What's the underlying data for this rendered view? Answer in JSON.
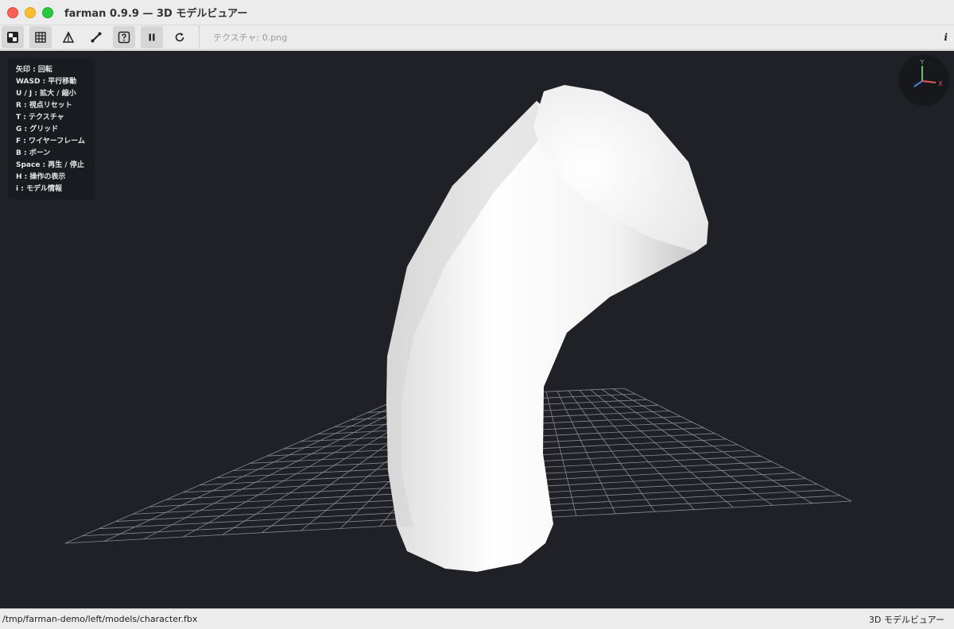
{
  "window": {
    "title": "farman 0.9.9 — 3D モデルビュアー"
  },
  "toolbar": {
    "buttons": [
      {
        "name": "texture-toggle-button",
        "icon": "texture-icon",
        "active": true
      },
      {
        "name": "grid-toggle-button",
        "icon": "grid-icon",
        "active": true
      },
      {
        "name": "wireframe-toggle-button",
        "icon": "wireframe-icon",
        "active": false
      },
      {
        "name": "bone-toggle-button",
        "icon": "bone-icon",
        "active": false
      },
      {
        "name": "help-toggle-button",
        "icon": "help-icon",
        "active": true
      },
      {
        "name": "pause-button",
        "icon": "pause-icon",
        "active": true
      },
      {
        "name": "reset-view-button",
        "icon": "reset-icon",
        "active": false
      }
    ],
    "texture_label": "テクスチャ: 0.png",
    "info_label": "i"
  },
  "help": {
    "lines": [
      "矢印 : 回転",
      "WASD : 平行移動",
      "U / J : 拡大 / 縮小",
      "R : 視点リセット",
      "T : テクスチャ",
      "G : グリッド",
      "F : ワイヤーフレーム",
      "B : ボーン",
      "Space : 再生 / 停止",
      "H : 操作の表示",
      "i : モデル情報"
    ]
  },
  "gizmo": {
    "y_label": "Y",
    "x_label": "X",
    "colors": {
      "x": "#e25858",
      "y": "#63c46b",
      "z": "#4f7de0"
    }
  },
  "status": {
    "path": "/tmp/farman-demo/left/models/character.fbx",
    "mode": "3D モデルビュアー"
  },
  "colors": {
    "viewport_bg": "#202127",
    "grid_line": "#8a8b90",
    "model": "#ffffff"
  }
}
